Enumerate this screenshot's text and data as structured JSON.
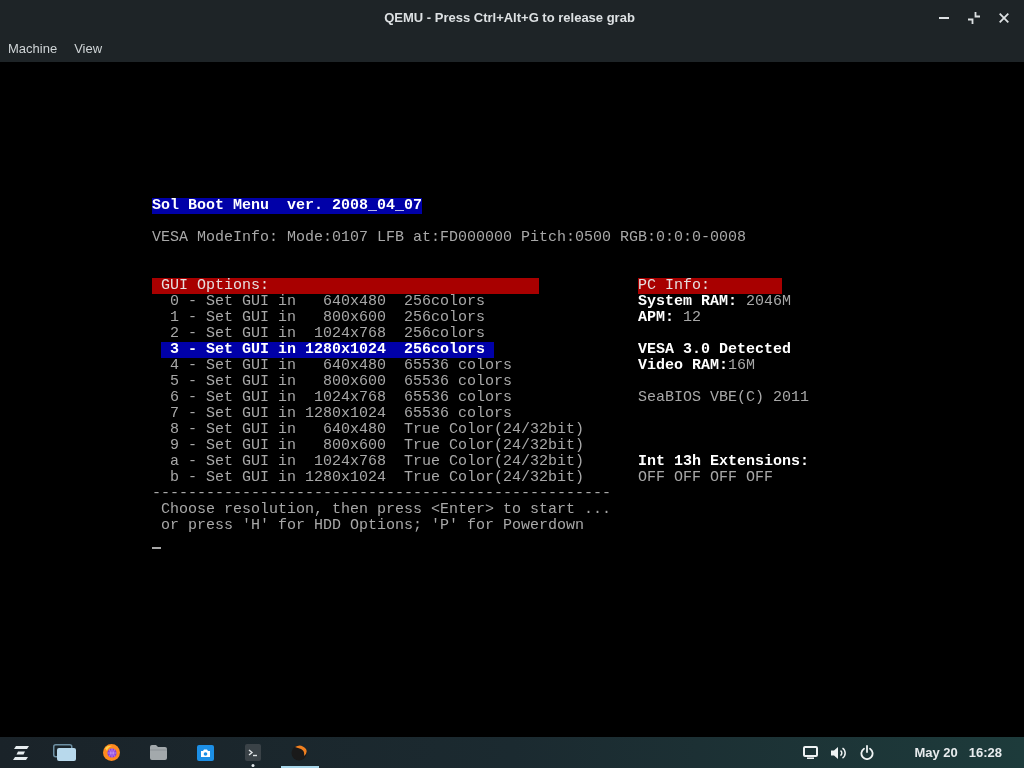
{
  "window": {
    "title": "QEMU - Press Ctrl+Alt+G to release grab"
  },
  "menu_bar": [
    "Machine",
    "View"
  ],
  "boot_screen": {
    "title": "Sol Boot Menu  ver. 2008_04_07",
    "mode_info": "VESA ModeInfo: Mode:0107 LFB at:FD000000 Pitch:0500 RGB:0:0:0-0008",
    "gui_options": {
      "title": "GUI Options:",
      "items": [
        {
          "text": "0 - Set GUI in   640x480  256colors",
          "selected": false
        },
        {
          "text": "1 - Set GUI in   800x600  256colors",
          "selected": false
        },
        {
          "text": "2 - Set GUI in  1024x768  256colors",
          "selected": false
        },
        {
          "text": "3 - Set GUI in 1280x1024  256colors",
          "selected": true
        },
        {
          "text": "4 - Set GUI in   640x480  65536 colors",
          "selected": false
        },
        {
          "text": "5 - Set GUI in   800x600  65536 colors",
          "selected": false
        },
        {
          "text": "6 - Set GUI in  1024x768  65536 colors",
          "selected": false
        },
        {
          "text": "7 - Set GUI in 1280x1024  65536 colors",
          "selected": false
        },
        {
          "text": "8 - Set GUI in   640x480  True Color(24/32bit)",
          "selected": false
        },
        {
          "text": "9 - Set GUI in   800x600  True Color(24/32bit)",
          "selected": false
        },
        {
          "text": "a - Set GUI in  1024x768  True Color(24/32bit)",
          "selected": false
        },
        {
          "text": "b - Set GUI in 1280x1024  True Color(24/32bit)",
          "selected": false
        }
      ]
    },
    "pc_info": {
      "title": "PC Info:",
      "groups": [
        {
          "lines": [
            {
              "kind": "field",
              "text": "**System RAM:** 2046M"
            },
            {
              "kind": "field",
              "text": "**APM:** 12"
            }
          ]
        },
        {
          "lines": [
            {
              "kind": "notice",
              "text": "VESA 3.0 Detected"
            },
            {
              "kind": "field",
              "text": "**Video RAM:**16M"
            }
          ]
        },
        {
          "lines": [
            {
              "kind": "plain",
              "text": "SeaBIOS VBE(C) 2011"
            }
          ]
        },
        {
          "lines": [
            {
              "kind": "notice",
              "text": "Int 13h Extensions:"
            },
            {
              "kind": "plain",
              "text": "OFF OFF OFF OFF"
            }
          ]
        }
      ]
    },
    "separator": "---------------------------------------------------",
    "prompt": [
      "Choose resolution, then press <Enter> to start ...",
      "or press 'H' for HDD Options; 'P' for Powerdown"
    ]
  },
  "taskbar": {
    "apps": [
      {
        "kind": "launcher",
        "running": false,
        "active": false
      },
      {
        "kind": "windows",
        "running": false,
        "active": false
      },
      {
        "kind": "browser",
        "running": false,
        "active": false
      },
      {
        "kind": "files",
        "running": false,
        "active": false
      },
      {
        "kind": "camera",
        "running": false,
        "active": false
      },
      {
        "kind": "terminal",
        "running": true,
        "active": false
      },
      {
        "kind": "emulator",
        "running": false,
        "active": true
      }
    ],
    "tray": [
      {
        "kind": "display"
      },
      {
        "kind": "volume"
      },
      {
        "kind": "power"
      }
    ],
    "date": "May 20",
    "time": "16:28"
  }
}
